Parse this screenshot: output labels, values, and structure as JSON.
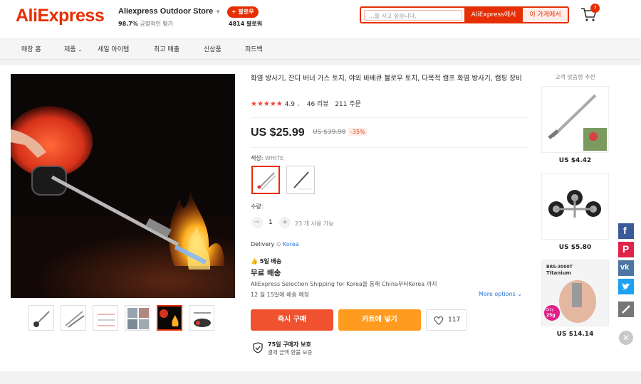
{
  "header": {
    "logo": "AliExpress",
    "store_name": "Aliexpress Outdoor Store",
    "store_rating_value": "98.7%",
    "store_rating_label": "긍정적인 평가",
    "follow_label": "+ 팔로우",
    "followers": "4814 팔로워",
    "search_placeholder": "...을 사고 싶습니다.",
    "search_aliexpress": "AliExpress에서",
    "search_store": "이 가게에서",
    "cart_count": "7"
  },
  "nav": {
    "items": [
      "매장 홈",
      "제품",
      "세일 아이템",
      "최고 매출",
      "신상품",
      "피드백"
    ]
  },
  "product": {
    "title": "화염 방사기, 잔디 버너 가스 토치, 야외 바베큐 블로우 토치, 다목적 캠프 화염 방사기, 캠핑 장비",
    "rating": "4.9",
    "reviews": "46 리뷰",
    "orders": "211 주문",
    "price": "US $25.99",
    "old_price": "US $39.98",
    "discount": "-35%",
    "color_label": "색상:",
    "color_value": "WHITE",
    "qty_label": "수량:",
    "qty_value": "1",
    "qty_available": "23 개 사용 가능",
    "delivery_label": "Delivery",
    "delivery_location": "Korea",
    "ship_days": "5일 배송",
    "free_shipping": "무료 배송",
    "ship_desc": "AliExpress Selection Shipping for Korea을 통해 China부터Korea 까지",
    "ship_date": "12 월 15일에 배송 예정",
    "more_options": "More options",
    "buy_now": "즉시 구매",
    "add_cart": "카트에 넣기",
    "wish_count": "117",
    "protect_title": "75일 구매자 보호",
    "protect_sub": "결제 금액 환불 보증"
  },
  "recommend": {
    "title": "고객 맞춤형 추천",
    "items": [
      {
        "price": "US $4.42"
      },
      {
        "price": "US $5.80"
      },
      {
        "price": "US $14.14",
        "badge_top": "BRS-3000T",
        "badge_name": "Titanium",
        "badge_only": "Only",
        "badge_weight": "25g"
      }
    ]
  },
  "colors": {
    "accent": "#e62e04",
    "buy": "#f0512e",
    "cart": "#ff9b1e",
    "link": "#2976d8"
  },
  "share_icons": [
    "facebook-icon",
    "pinterest-icon",
    "vk-icon",
    "twitter-icon",
    "pencil-icon"
  ]
}
